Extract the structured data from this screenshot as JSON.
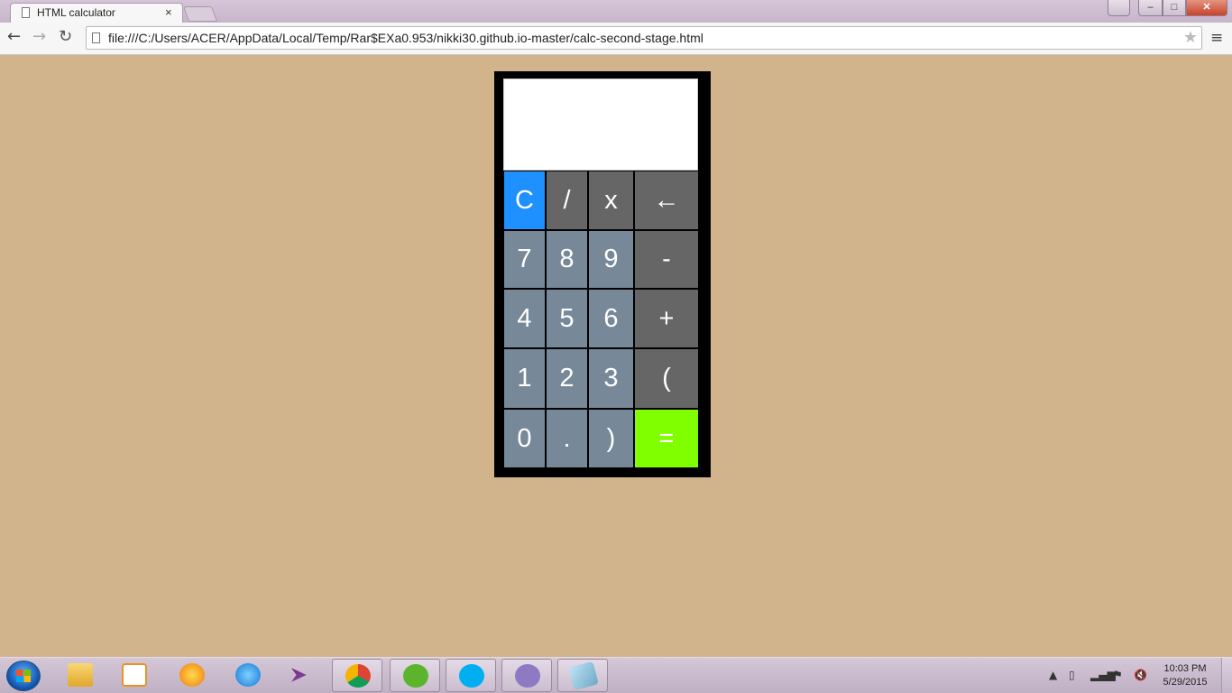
{
  "browser": {
    "tab_title": "HTML calculator",
    "tab_close": "×",
    "url": "file:///C:/Users/ACER/AppData/Local/Temp/Rar$EXa0.953/nikki30.github.io-master/calc-second-stage.html",
    "back_icon": "←",
    "forward_icon": "→",
    "reload_icon": "↻",
    "star_icon": "★",
    "menu_icon": "≡",
    "window_buttons": {
      "minimize": "–",
      "maximize": "□",
      "close": "✕",
      "user": "👤"
    }
  },
  "calculator": {
    "display_value": "",
    "keys": [
      {
        "label": "C",
        "kind": "clear"
      },
      {
        "label": "/",
        "kind": "op"
      },
      {
        "label": "x",
        "kind": "op"
      },
      {
        "label": "←",
        "kind": "op"
      },
      {
        "label": "7",
        "kind": "num"
      },
      {
        "label": "8",
        "kind": "num"
      },
      {
        "label": "9",
        "kind": "num"
      },
      {
        "label": "-",
        "kind": "op"
      },
      {
        "label": "4",
        "kind": "num"
      },
      {
        "label": "5",
        "kind": "num"
      },
      {
        "label": "6",
        "kind": "num"
      },
      {
        "label": "+",
        "kind": "op"
      },
      {
        "label": "1",
        "kind": "num"
      },
      {
        "label": "2",
        "kind": "num"
      },
      {
        "label": "3",
        "kind": "num"
      },
      {
        "label": "(",
        "kind": "op"
      },
      {
        "label": "0",
        "kind": "num"
      },
      {
        "label": ".",
        "kind": "num"
      },
      {
        "label": ")",
        "kind": "num"
      },
      {
        "label": "=",
        "kind": "equals"
      }
    ],
    "colors": {
      "page_background": "#D2B48C",
      "frame": "#000000",
      "num_key": "#778899",
      "op_key": "#666666",
      "clear_key": "#1E90FF",
      "equals_key": "#7FFF00",
      "display": "#FFFFFF"
    }
  },
  "taskbar": {
    "items": [
      {
        "name": "windows-explorer-icon"
      },
      {
        "name": "media-player-icon"
      },
      {
        "name": "firefox-icon"
      },
      {
        "name": "internet-explorer-icon"
      },
      {
        "name": "visual-studio-icon"
      },
      {
        "name": "chrome-icon"
      },
      {
        "name": "utorrent-icon"
      },
      {
        "name": "skype-icon"
      },
      {
        "name": "github-icon"
      },
      {
        "name": "notepad-icon"
      }
    ],
    "clock_time": "10:03 PM",
    "clock_date": "5/29/2015"
  }
}
